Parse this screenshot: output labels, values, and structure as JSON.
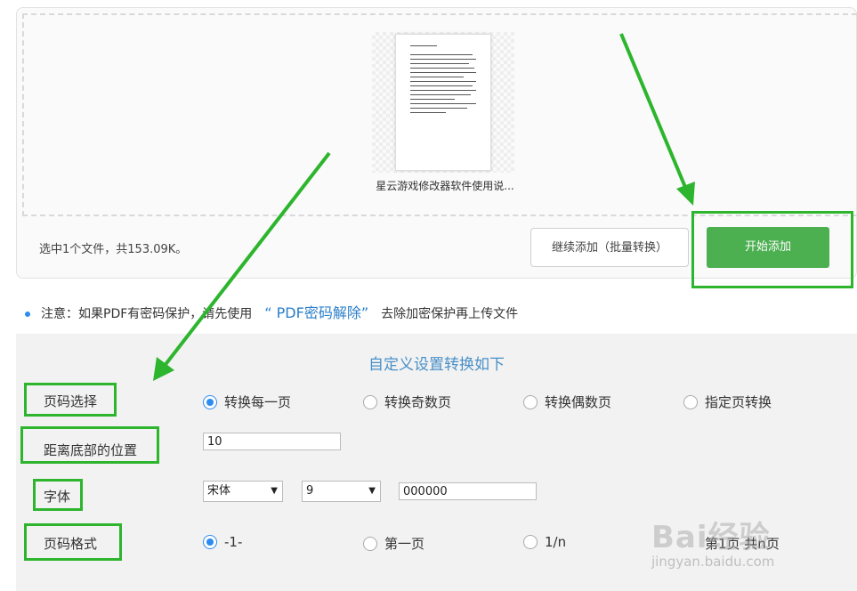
{
  "upload": {
    "file_name": "星云游戏修改器软件使用说...",
    "summary": "选中1个文件，共153.09K。",
    "continue_label": "继续添加（批量转换）",
    "start_label": "开始添加"
  },
  "notice": {
    "prefix": "注意：如果PDF有密码保护，请先使用",
    "link": "“ PDF密码解除”",
    "suffix": "去除加密保护再上传文件"
  },
  "settings": {
    "title": "自定义设置转换如下",
    "page_select": {
      "label": "页码选择",
      "options": [
        "转换每一页",
        "转换奇数页",
        "转换偶数页",
        "指定页转换"
      ],
      "selected": 0
    },
    "position": {
      "label": "距离底部的位置",
      "value": "10"
    },
    "font": {
      "label": "字体",
      "family": "宋体",
      "size": "9",
      "color": "000000"
    },
    "page_format": {
      "label": "页码格式",
      "options": [
        "-1-",
        "第一页",
        "1/n",
        "第1页 共n页"
      ],
      "selected": 0
    }
  },
  "watermark": {
    "logo": "Bai经验",
    "url": "jingyan.baidu.com"
  },
  "colors": {
    "accent_green": "#4caf50",
    "highlight_green": "#2db52d",
    "link_blue": "#2a7ec9",
    "radio_blue": "#2d8cf0"
  }
}
